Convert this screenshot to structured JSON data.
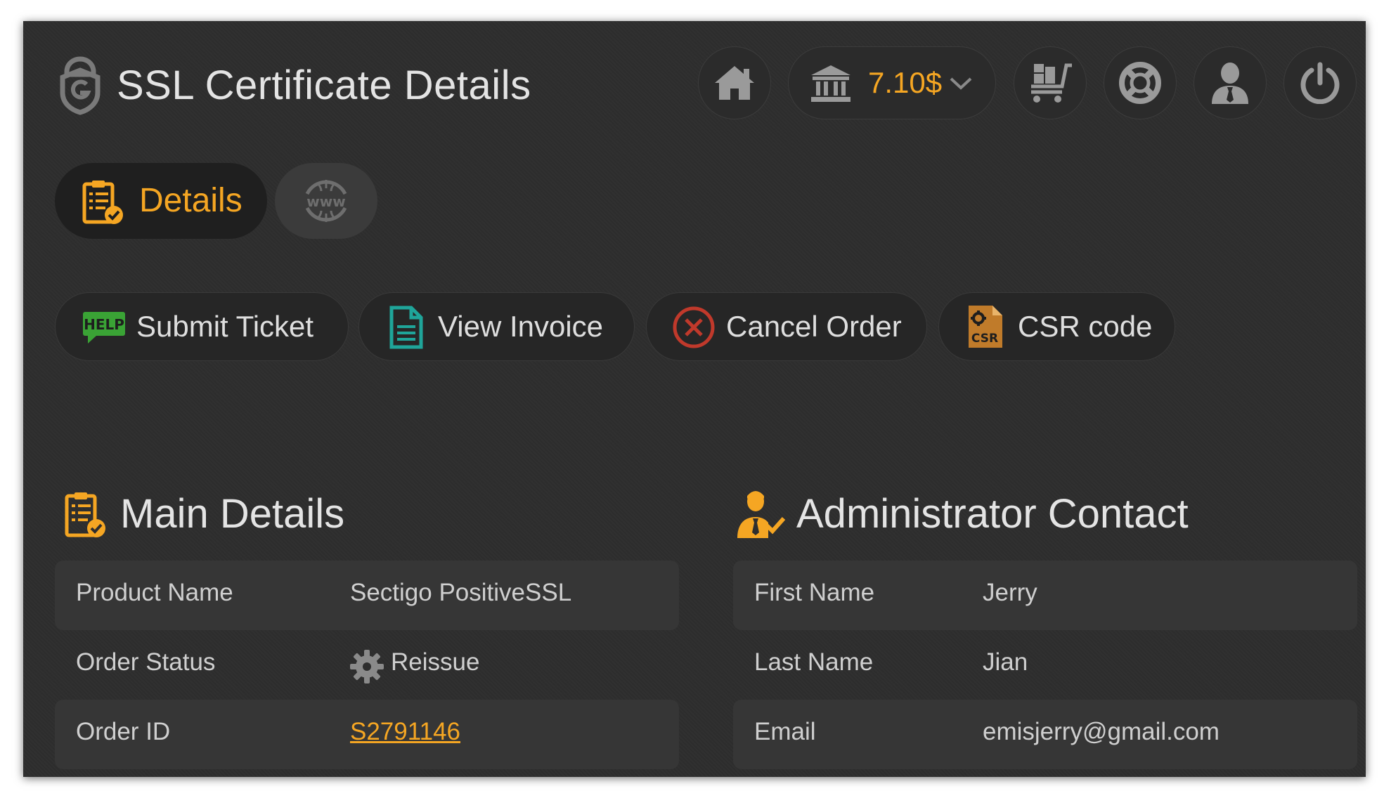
{
  "header": {
    "title": "SSL Certificate Details",
    "balance": "7.10$"
  },
  "icons": {
    "title": "shield-g-icon",
    "home": "home-icon",
    "balance": "bank-icon",
    "cart": "cart-icon",
    "support": "lifebuoy-icon",
    "account": "user-icon",
    "logout": "power-icon"
  },
  "tabs": [
    {
      "label": "Details",
      "icon": "clipboard-check-icon",
      "active": true
    },
    {
      "label": "",
      "icon": "www-globe-icon",
      "active": false
    }
  ],
  "actions": {
    "submit_ticket": "Submit Ticket",
    "view_invoice": "View Invoice",
    "cancel_order": "Cancel Order",
    "csr_code": "CSR code",
    "help_badge": "HELP",
    "csr_badge": "CSR"
  },
  "main_details": {
    "title": "Main Details",
    "rows": [
      {
        "key": "Product Name",
        "value": "Sectigo PositiveSSL"
      },
      {
        "key": "Order Status",
        "value": "Reissue"
      },
      {
        "key": "Order ID",
        "value": "S2791146"
      }
    ]
  },
  "admin_contact": {
    "title": "Administrator Contact",
    "rows": [
      {
        "key": "First Name",
        "value": "Jerry"
      },
      {
        "key": "Last Name",
        "value": "Jian"
      },
      {
        "key": "Email",
        "value": "emisjerry@gmail.com"
      }
    ]
  },
  "colors": {
    "accent": "#f5a623",
    "background": "#2e2e2e",
    "text": "#e4e4e4",
    "invoice_icon": "#1fa59a",
    "cancel_icon": "#c0392b",
    "help_badge": "#3aa335"
  }
}
